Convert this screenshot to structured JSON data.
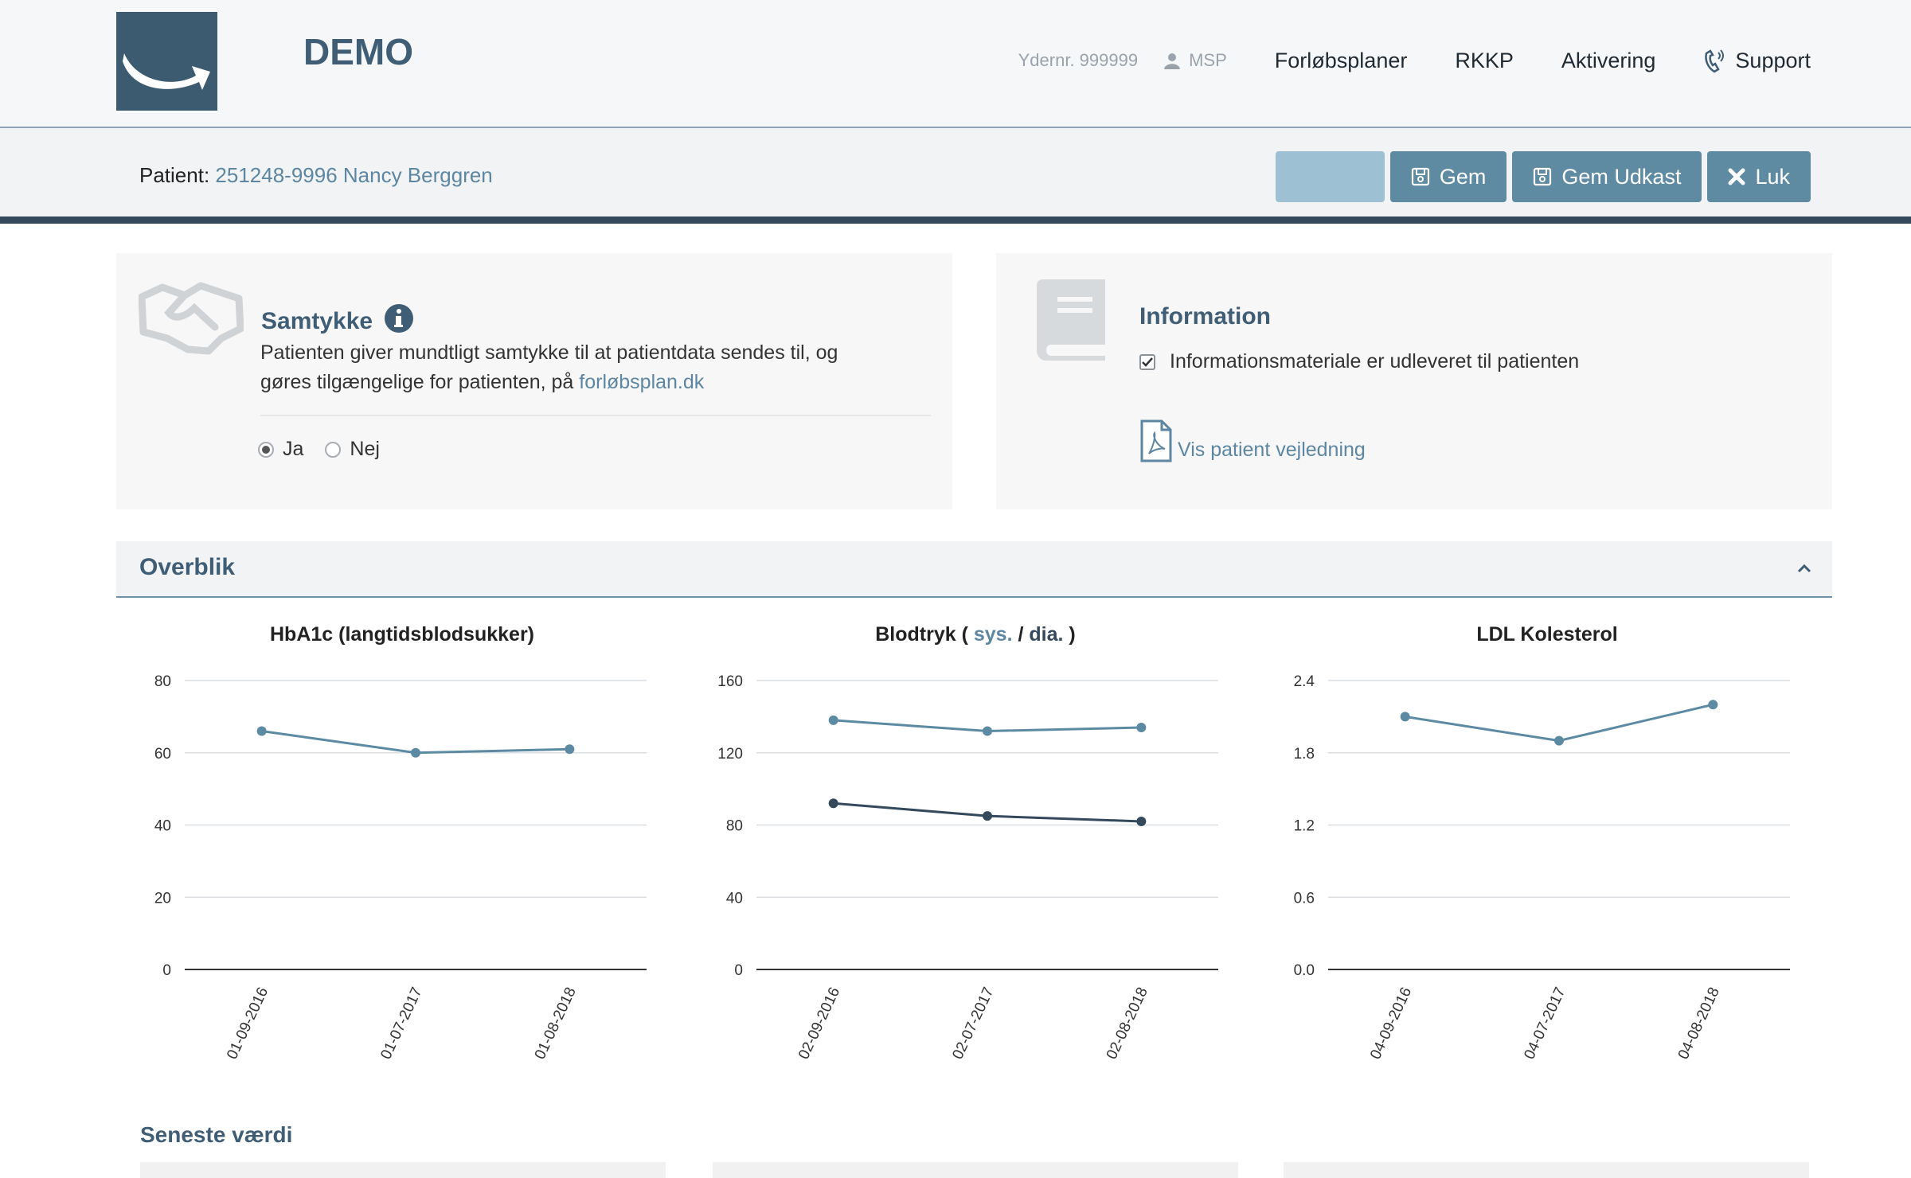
{
  "header": {
    "brand": "DEMO",
    "ydernr": "Ydernr. 999999",
    "user": "MSP",
    "nav": [
      "Forløbsplaner",
      "RKKP",
      "Aktivering",
      "Support"
    ]
  },
  "patientbar": {
    "label": "Patient:",
    "value": "251248-9996 Nancy Berggren",
    "buttons": {
      "disabled": "",
      "save": "Gem",
      "save_draft": "Gem Udkast",
      "close": "Luk"
    }
  },
  "samtykke": {
    "title": "Samtykke",
    "text1": "Patienten giver mundtligt samtykke til at patientdata sendes til, og",
    "text2": "gøres tilgængelige for patienten, på",
    "link": "forløbsplan.dk",
    "options": [
      "Ja",
      "Nej"
    ],
    "selected": "Ja"
  },
  "information": {
    "title": "Information",
    "checkbox_label": "Informationsmateriale er udleveret til patienten",
    "checked": true,
    "link": "Vis patient vejledning"
  },
  "overblik": {
    "title": "Overblik"
  },
  "charts": {
    "hba1c": {
      "title": "HbA1c (langtidsblodsukker)"
    },
    "bp": {
      "title_a": "Blodtryk ( ",
      "sys": "sys.",
      "slash": " / ",
      "dia": "dia.",
      "title_b": " )"
    },
    "ldl": {
      "title": "LDL Kolesterol"
    }
  },
  "chart_data": [
    {
      "type": "line",
      "title": "HbA1c (langtidsblodsukker)",
      "categories": [
        "01-09-2016",
        "01-07-2017",
        "01-08-2018"
      ],
      "series": [
        {
          "values": [
            66,
            60,
            61
          ]
        }
      ],
      "ylim": [
        0,
        80
      ],
      "yticks": [
        "0",
        "20",
        "40",
        "60",
        "80"
      ],
      "grid": true
    },
    {
      "type": "line",
      "title": "Blodtryk ( sys. / dia. )",
      "categories": [
        "02-09-2016",
        "02-07-2017",
        "02-08-2018"
      ],
      "series": [
        {
          "name": "sys.",
          "values": [
            138,
            132,
            134
          ]
        },
        {
          "name": "dia.",
          "values": [
            92,
            85,
            82
          ]
        }
      ],
      "ylim": [
        0,
        160
      ],
      "yticks": [
        "0",
        "40",
        "80",
        "120",
        "160"
      ],
      "grid": true
    },
    {
      "type": "line",
      "title": "LDL Kolesterol",
      "categories": [
        "04-09-2016",
        "04-07-2017",
        "04-08-2018"
      ],
      "series": [
        {
          "values": [
            2.1,
            1.9,
            2.2
          ]
        }
      ],
      "ylim": [
        0,
        2.4
      ],
      "yticks": [
        "0.0",
        "0.6",
        "1.2",
        "1.8",
        "2.4"
      ],
      "grid": true
    }
  ],
  "colors": {
    "primary": "#3f5d75",
    "accent": "#5e8aa2",
    "series_light": "#5c8aa3",
    "series_dark": "#34495c"
  },
  "seneste": {
    "title": "Seneste værdi"
  }
}
